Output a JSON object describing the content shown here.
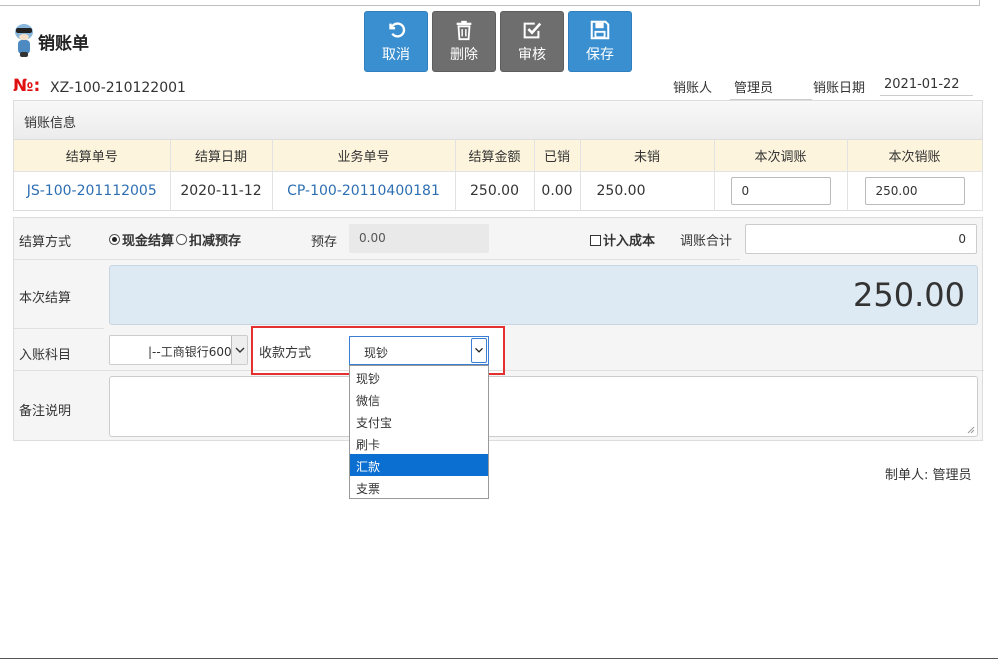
{
  "page": {
    "title": "销账单"
  },
  "toolbar": {
    "cancel_label": "取消",
    "delete_label": "删除",
    "review_label": "审核",
    "save_label": "保存",
    "colors": {
      "blue": "#3a8fd0",
      "gray": "#6e6e6e"
    }
  },
  "header": {
    "no_label": "№:",
    "no_value": "XZ-100-210122001",
    "writer_label": "销账人",
    "writer_value": "管理员",
    "date_label": "销账日期",
    "date_value": "2021-01-22"
  },
  "info": {
    "section_title": "销账信息",
    "columns": [
      "结算单号",
      "结算日期",
      "业务单号",
      "结算金额",
      "已销",
      "未销",
      "本次调账",
      "本次销账"
    ],
    "rows": [
      {
        "settle_no": "JS-100-201112005",
        "settle_date": "2020-11-12",
        "biz_no": "CP-100-20110400181",
        "amount": "250.00",
        "cleared": "0.00",
        "uncleared": "250.00",
        "adjust": "0",
        "writeoff": "250.00"
      }
    ]
  },
  "form": {
    "method_label": "结算方式",
    "method_cash": "现金结算",
    "method_prepaid": "扣减预存",
    "prepaid_label": "预存",
    "prepaid_value": "0.00",
    "cost_label": "计入成本",
    "adjust_total_label": "调账合计",
    "adjust_total_value": "0",
    "current_label": "本次结算",
    "current_value": "250.00",
    "account_label": "入账科目",
    "account_value": "|--工商银行600",
    "pay_label": "收款方式",
    "pay_value": "现钞",
    "remark_label": "备注说明"
  },
  "pay_options": [
    "现钞",
    "微信",
    "支付宝",
    "刷卡",
    "汇款",
    "支票"
  ],
  "pay_options_highlighted": "汇款",
  "footer": {
    "maker_label": "制单人:",
    "maker_value": "管理员"
  }
}
